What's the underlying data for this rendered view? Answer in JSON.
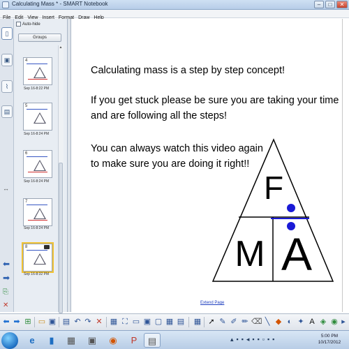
{
  "window": {
    "title": "Calculating Mass * - SMART Notebook",
    "minimize": "–",
    "maximize": "□",
    "close": "✕"
  },
  "menu": [
    "File",
    "Edit",
    "View",
    "Insert",
    "Format",
    "Draw",
    "Help"
  ],
  "sidebar": {
    "autohide_label": "Auto-hide",
    "groups_button": "Groups",
    "thumbnails": [
      {
        "number": "4",
        "date": "Sep 16-8:22 PM",
        "selected": false
      },
      {
        "number": "5",
        "date": "Sep 16-8:24 PM",
        "selected": false
      },
      {
        "number": "6",
        "date": "Sep 16-8:24 PM",
        "selected": false
      },
      {
        "number": "7",
        "date": "Sep 16-8:24 PM",
        "selected": false
      },
      {
        "number": "8",
        "date": "Sep 16-8:32 PM",
        "selected": true
      }
    ]
  },
  "page": {
    "lines": [
      "Calculating mass is a step by step concept!",
      "If you get stuck please be sure you are taking your time",
      "and are following all the steps!",
      "You can always watch this video again",
      "to make sure you are doing it right!!"
    ],
    "triangle": {
      "top": "F",
      "left": "M",
      "right": "A"
    },
    "extend_page": "Extend Page"
  },
  "clock": {
    "time": "5:00 PM",
    "date": "10/17/2012"
  },
  "colors": {
    "accent": "#2b5fb0",
    "dot": "#1a1ad6",
    "selection": "#f1c232"
  }
}
